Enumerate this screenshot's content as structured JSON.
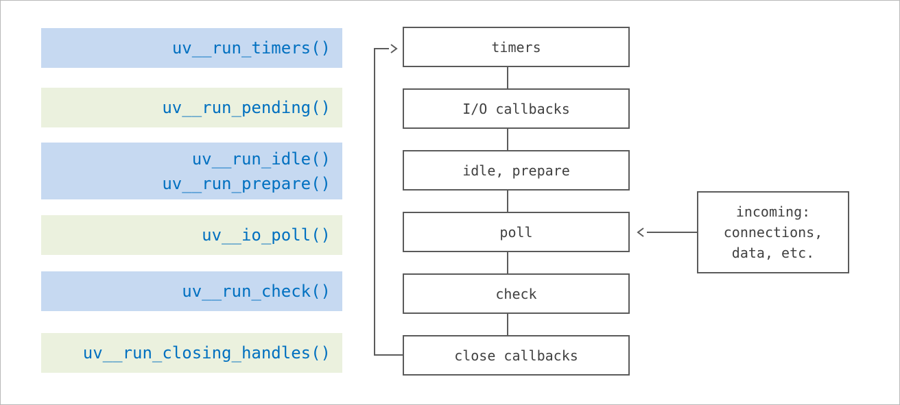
{
  "functions": [
    {
      "lines": [
        "uv__run_timers()"
      ],
      "color": "#c6d9f1"
    },
    {
      "lines": [
        "uv__run_pending()"
      ],
      "color": "#ebf1de"
    },
    {
      "lines": [
        "uv__run_idle()",
        "uv__run_prepare()"
      ],
      "color": "#c6d9f1"
    },
    {
      "lines": [
        "uv__io_poll()"
      ],
      "color": "#ebf1de"
    },
    {
      "lines": [
        "uv__run_check()"
      ],
      "color": "#c6d9f1"
    },
    {
      "lines": [
        "uv__run_closing_handles()"
      ],
      "color": "#ebf1de"
    }
  ],
  "phases": [
    "timers",
    "I/O callbacks",
    "idle, prepare",
    "poll",
    "check",
    "close callbacks"
  ],
  "incoming": [
    "incoming:",
    "connections,",
    "data, etc."
  ],
  "colors": {
    "function_text": "#0070c0",
    "phase_border": "#5a5a5a"
  }
}
